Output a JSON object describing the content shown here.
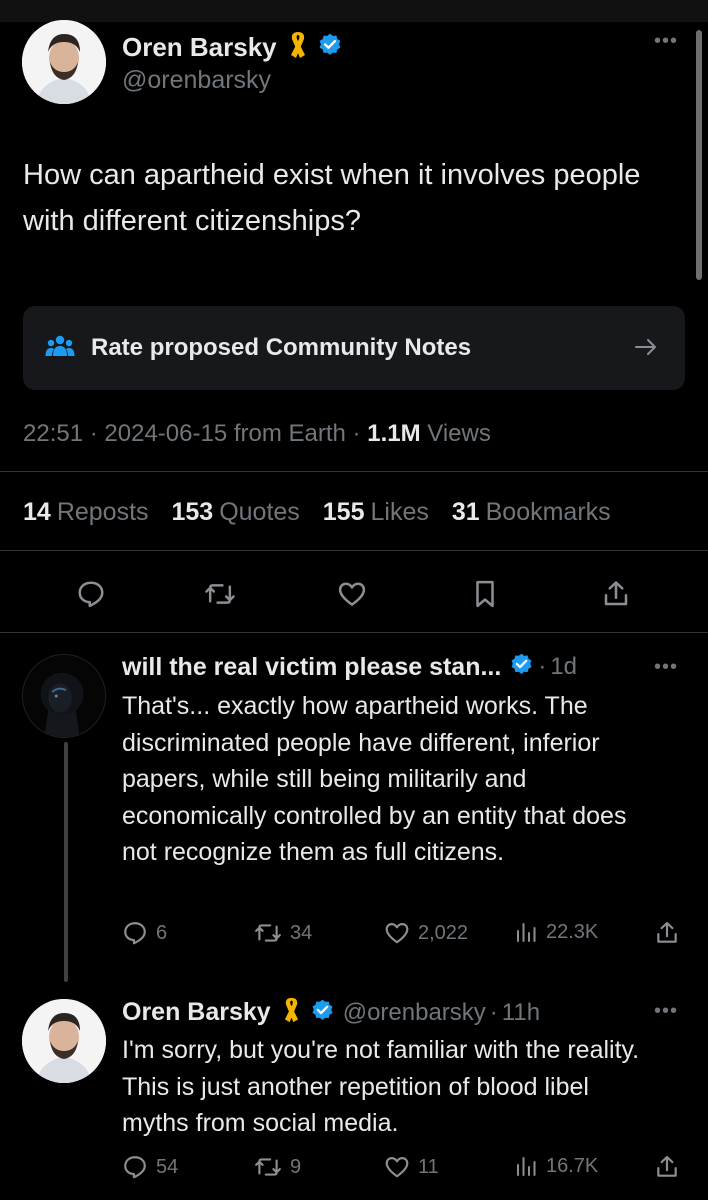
{
  "main_tweet": {
    "author_name": "Oren Barsky",
    "author_handle": "@orenbarsky",
    "text": "How can apartheid exist when it involves people with different citizenships?",
    "community_notes_label": "Rate proposed Community Notes",
    "time": "22:51",
    "date": "2024-06-15",
    "location": "from Earth",
    "views_count": "1.1M",
    "views_label": "Views",
    "stats": [
      {
        "count": "14",
        "label": "Reposts"
      },
      {
        "count": "153",
        "label": "Quotes"
      },
      {
        "count": "155",
        "label": "Likes"
      },
      {
        "count": "31",
        "label": "Bookmarks"
      }
    ]
  },
  "replies": [
    {
      "author_name": "will the real victim please stan...",
      "age": "1d",
      "text": "That's... exactly how apartheid works. The discriminated people have different, inferior papers, while still being militarily and economically controlled by an entity that does not recognize them as full citizens.",
      "replies_count": "6",
      "reposts_count": "34",
      "likes_count": "2,022",
      "views_count": "22.3K"
    },
    {
      "author_name": "Oren Barsky",
      "author_handle": "@orenbarsky",
      "age": "11h",
      "text": "I'm sorry, but you're not familiar with the reality. This is just another repetition of blood libel myths from social media.",
      "replies_count": "54",
      "reposts_count": "9",
      "likes_count": "11",
      "views_count": "16.7K"
    }
  ],
  "colors": {
    "background": "#000000",
    "text_primary": "#e7e9ea",
    "text_secondary": "#71767b",
    "verified_blue": "#1d9bf0",
    "ribbon_yellow": "#f4b400",
    "notes_bg": "#16181c",
    "divider": "#2f3336"
  },
  "icons": {
    "verified": "verified-badge-icon",
    "ribbon": "yellow-ribbon-icon",
    "community_notes": "people-icon",
    "arrow": "arrow-right-icon",
    "reply": "reply-icon",
    "repost": "repost-icon",
    "like": "heart-icon",
    "bookmark": "bookmark-icon",
    "share": "share-icon",
    "views": "views-chart-icon",
    "more": "more-dots-icon"
  }
}
